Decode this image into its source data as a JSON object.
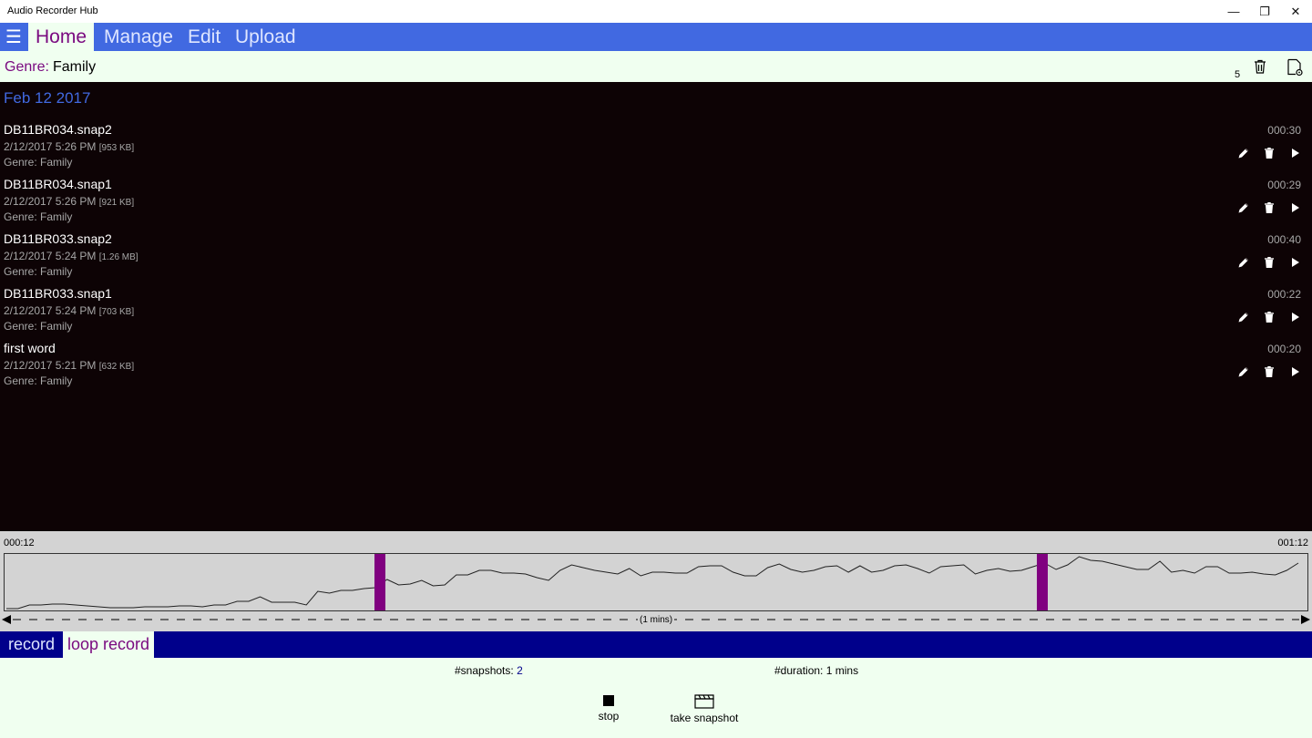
{
  "window": {
    "title": "Audio Recorder Hub",
    "minimize_glyph": "—",
    "restore_glyph": "❐",
    "close_glyph": "✕"
  },
  "nav": {
    "menu_glyph": "☰",
    "tabs": [
      {
        "label": "Home",
        "active": true
      },
      {
        "label": "Manage",
        "active": false
      },
      {
        "label": "Edit",
        "active": false
      },
      {
        "label": "Upload",
        "active": false
      }
    ]
  },
  "genre_header": {
    "label": "Genre:",
    "value": "Family",
    "count": "5",
    "icons": [
      "trash-icon",
      "settings-doc-icon"
    ]
  },
  "list": {
    "date_header": "Feb 12 2017",
    "items": [
      {
        "name": "DB11BR034.snap2",
        "datetime": "2/12/2017 5:26 PM",
        "size": "[953 KB]",
        "genre": "Genre: Family",
        "duration": "000:30"
      },
      {
        "name": "DB11BR034.snap1",
        "datetime": "2/12/2017 5:26 PM",
        "size": "[921 KB]",
        "genre": "Genre: Family",
        "duration": "000:29"
      },
      {
        "name": "DB11BR033.snap2",
        "datetime": "2/12/2017 5:24 PM",
        "size": "[1.26 MB]",
        "genre": "Genre: Family",
        "duration": "000:40"
      },
      {
        "name": "DB11BR033.snap1",
        "datetime": "2/12/2017 5:24 PM",
        "size": "[703 KB]",
        "genre": "Genre: Family",
        "duration": "000:22"
      },
      {
        "name": "first word",
        "datetime": "2/12/2017 5:21 PM",
        "size": "[632 KB]",
        "genre": "Genre: Family",
        "duration": "000:20"
      }
    ],
    "item_actions": [
      "pencil-icon",
      "trash-icon",
      "play-icon"
    ]
  },
  "timeline": {
    "start_time": "000:12",
    "end_time": "001:12",
    "scale_label": "(1 mins)",
    "marker_color": "#800080",
    "wave_color": "#222222"
  },
  "mode_tabs": [
    {
      "label": "record",
      "active": false
    },
    {
      "label": "loop record",
      "active": true
    }
  ],
  "controls": {
    "snapshots_label": "#snapshots:",
    "snapshots_value": "2",
    "duration_label": "#duration:",
    "duration_value": "1 mins",
    "stop_label": "stop",
    "snapshot_label": "take snapshot"
  },
  "colors": {
    "accent_blue": "#4169e1",
    "active_purple": "#7a0a80",
    "panel_green": "#f0fff0",
    "list_bg": "#0d0305",
    "mode_bar": "#00008b"
  }
}
